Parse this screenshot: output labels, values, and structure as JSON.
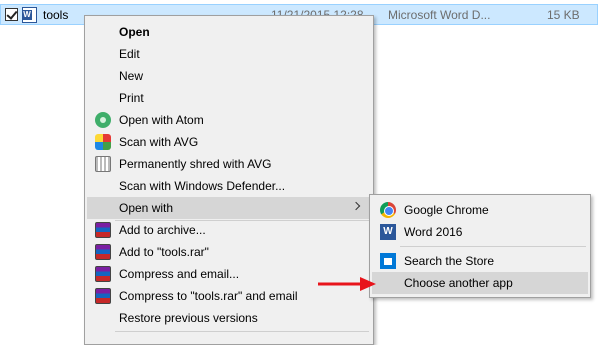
{
  "file": {
    "name": "tools",
    "date": "11/21/2015 12:28",
    "type": "Microsoft Word D...",
    "size": "15 KB"
  },
  "menu": {
    "items": [
      {
        "label": "Open",
        "bold": true
      },
      {
        "label": "Edit"
      },
      {
        "label": "New"
      },
      {
        "label": "Print"
      },
      {
        "label": "Open with Atom",
        "icon": "atom-icon"
      },
      {
        "label": "Scan with AVG",
        "icon": "avg-icon"
      },
      {
        "label": "Permanently shred with AVG",
        "icon": "shredder-icon"
      },
      {
        "label": "Scan with Windows Defender..."
      },
      {
        "label": "Open with",
        "highlighted": true
      },
      {
        "label": "Add to archive...",
        "icon": "winrar-icon"
      },
      {
        "label": "Add to \"tools.rar\"",
        "icon": "winrar-icon"
      },
      {
        "label": "Compress and email...",
        "icon": "winrar-icon"
      },
      {
        "label": "Compress to \"tools.rar\" and email",
        "icon": "winrar-icon"
      },
      {
        "label": "Restore previous versions"
      }
    ]
  },
  "submenu": {
    "items": [
      {
        "label": "Google Chrome",
        "icon": "chrome-icon"
      },
      {
        "label": "Word 2016",
        "icon": "word-icon"
      },
      {
        "label": "Search the Store",
        "icon": "store-icon"
      },
      {
        "label": "Choose another app",
        "highlighted": true
      }
    ]
  },
  "colors": {
    "selection": "#cce8ff",
    "menu_bg": "#f0f0f0",
    "highlight": "#d6d6d6",
    "annotation_arrow": "#e8141b"
  }
}
